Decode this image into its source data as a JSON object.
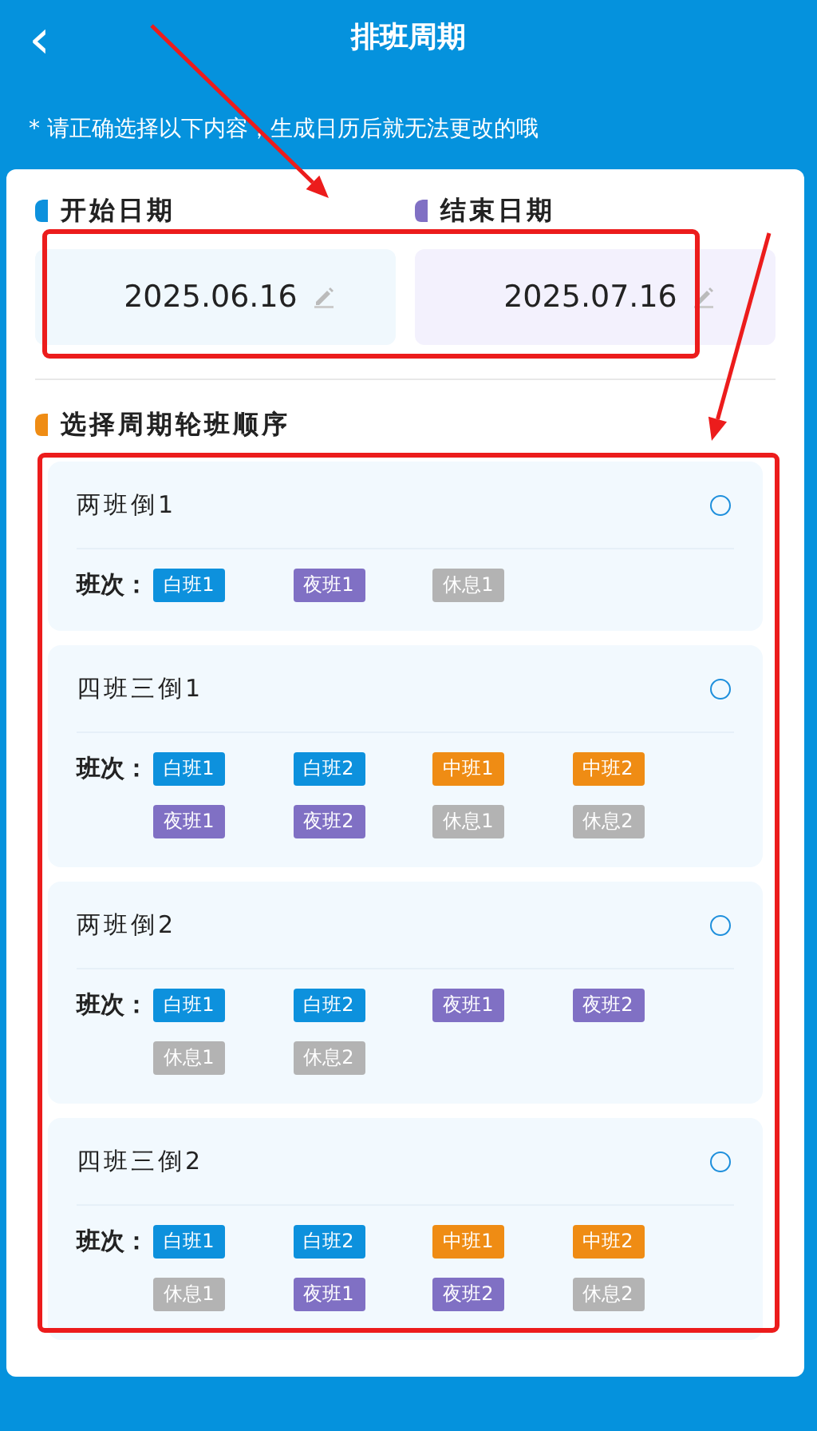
{
  "header": {
    "back_icon": "‹",
    "title": "排班周期"
  },
  "notice": "* 请正确选择以下内容，生成日历后就无法更改的哦",
  "date_fields": [
    {
      "label": "开始日期",
      "value": "2025.06.16",
      "color": "#0d91dd"
    },
    {
      "label": "结束日期",
      "value": "2025.07.16",
      "color": "#8070c4"
    }
  ],
  "section": {
    "title": "选择周期轮班顺序",
    "color": "#ef8c14"
  },
  "plans": [
    {
      "name": "两班倒1",
      "selected": false,
      "shifts_label": "班次：",
      "shifts": [
        {
          "label": "白班1",
          "color": "#0d91dd"
        },
        {
          "label": "夜班1",
          "color": "#8070c4"
        },
        {
          "label": "休息1",
          "color": "#b3b3b3"
        }
      ]
    },
    {
      "name": "四班三倒1",
      "selected": false,
      "shifts_label": "班次：",
      "shifts": [
        {
          "label": "白班1",
          "color": "#0d91dd"
        },
        {
          "label": "白班2",
          "color": "#0d91dd"
        },
        {
          "label": "中班1",
          "color": "#ef8c14"
        },
        {
          "label": "中班2",
          "color": "#ef8c14"
        },
        {
          "label": "夜班1",
          "color": "#8070c4"
        },
        {
          "label": "夜班2",
          "color": "#8070c4"
        },
        {
          "label": "休息1",
          "color": "#b3b3b3"
        },
        {
          "label": "休息2",
          "color": "#b3b3b3"
        }
      ]
    },
    {
      "name": "两班倒2",
      "selected": false,
      "shifts_label": "班次：",
      "shifts": [
        {
          "label": "白班1",
          "color": "#0d91dd"
        },
        {
          "label": "白班2",
          "color": "#0d91dd"
        },
        {
          "label": "夜班1",
          "color": "#8070c4"
        },
        {
          "label": "夜班2",
          "color": "#8070c4"
        },
        {
          "label": "休息1",
          "color": "#b3b3b3"
        },
        {
          "label": "休息2",
          "color": "#b3b3b3"
        }
      ]
    },
    {
      "name": "四班三倒2",
      "selected": false,
      "shifts_label": "班次：",
      "shifts": [
        {
          "label": "白班1",
          "color": "#0d91dd"
        },
        {
          "label": "白班2",
          "color": "#0d91dd"
        },
        {
          "label": "中班1",
          "color": "#ef8c14"
        },
        {
          "label": "中班2",
          "color": "#ef8c14"
        },
        {
          "label": "休息1",
          "color": "#b3b3b3"
        },
        {
          "label": "夜班1",
          "color": "#8070c4"
        },
        {
          "label": "夜班2",
          "color": "#8070c4"
        },
        {
          "label": "休息2",
          "color": "#b3b3b3"
        }
      ]
    }
  ],
  "annotations": [
    {
      "kind": "frame"
    },
    {
      "kind": "frame"
    },
    {
      "kind": "arrow"
    },
    {
      "kind": "arrow"
    }
  ]
}
